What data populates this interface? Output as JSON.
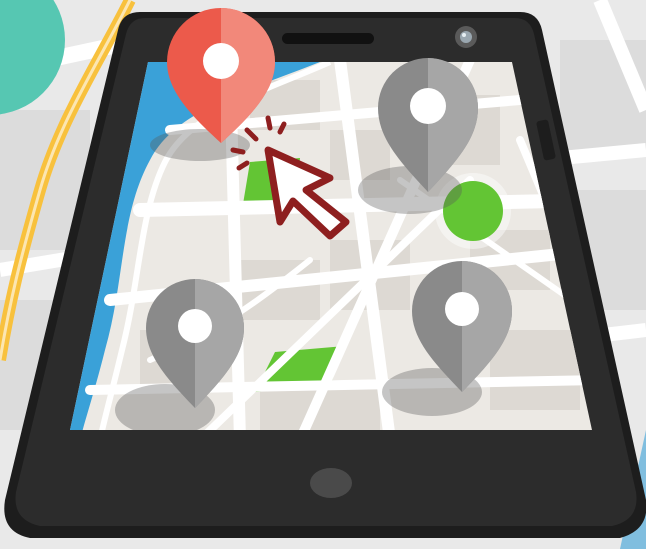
{
  "colors": {
    "background": "#e9e9e9",
    "map_land": "#ece9e4",
    "map_block": "#ddd9d3",
    "street": "#ffffff",
    "river": "#3aa1d8",
    "park": "#63c534",
    "highway": "#f8c13d",
    "teal_blob": "#56c7b2",
    "phone_body": "#2c2c2c",
    "phone_dark": "#1d1d1d",
    "active_pin": "#ec5a4b",
    "active_pin_light": "#f2887a",
    "pin_gray": "#8a8a8a",
    "pin_gray_light": "#a6a6a6",
    "cursor_outline": "#8e1f1f",
    "selected_point": "#63c534"
  },
  "icons": {
    "active_pin": "map-pin-icon",
    "inactive_pin": "map-pin-icon",
    "cursor": "mouse-pointer-icon",
    "camera": "front-camera-icon",
    "speaker": "speaker-grille-icon",
    "home_button": "home-button-icon"
  },
  "pins": {
    "active_count": 1,
    "inactive_count": 3
  }
}
